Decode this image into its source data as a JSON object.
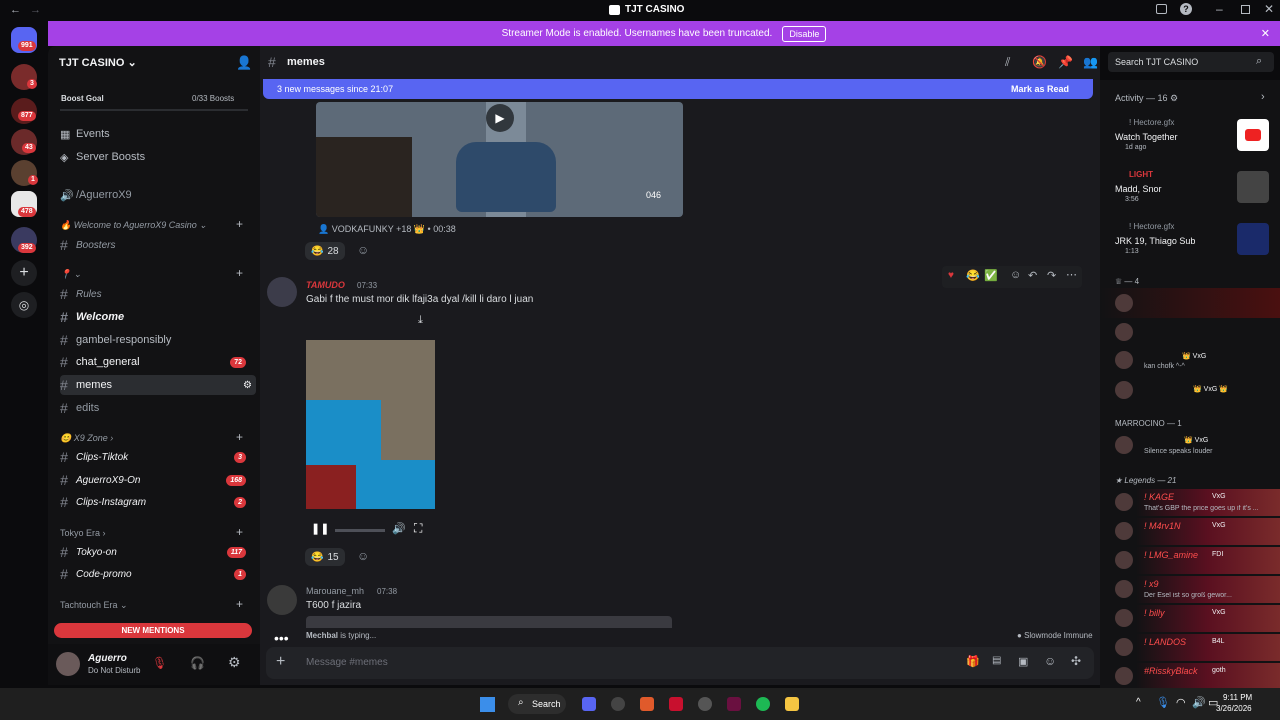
{
  "window": {
    "title": "TJT CASINO"
  },
  "banner": {
    "text": "Streamer Mode is enabled. Usernames have been truncated.",
    "button": "Disable"
  },
  "guilds": {
    "badges": [
      "991",
      "3",
      "877",
      "43",
      "1",
      "478",
      "392"
    ]
  },
  "server": {
    "name": "TJT CASINO",
    "boost_goal": "Boost Goal",
    "boost_count": "0/33 Boosts"
  },
  "sidebar": {
    "events": "Events",
    "server_boosts": "Server Boosts",
    "link_channel": "/AguerroX9",
    "cat1": "Welcome to AguerroX9 Casino",
    "boosters": "Boosters",
    "rules": "Rules",
    "welcome": "Welcome",
    "gamble": "gambel-responsibly",
    "chat_general": "chat_general",
    "chat_general_count": "72",
    "memes": "memes",
    "edits": "edits",
    "cat2": "X9 Zone",
    "clips_tiktok": "Clips-Tiktok",
    "clips_tiktok_count": "3",
    "aguerro_on": "AguerroX9-On",
    "aguerro_on_count": "168",
    "clips_insta": "Clips-Instagram",
    "clips_insta_count": "2",
    "cat3": "Tokyo Era",
    "tokyo_on": "Tokyo-on",
    "tokyo_on_count": "117",
    "code_promo": "Code-promo",
    "code_promo_count": "1",
    "cat4": "Tachtouch Era",
    "new_mentions": "NEW MENTIONS"
  },
  "user": {
    "name": "Aguerro",
    "status": "Do Not Disturb"
  },
  "channel": {
    "name": "memes",
    "search_placeholder": "Search TJT CASINO"
  },
  "new_messages": {
    "text": "3 new messages since 21:07",
    "mark": "Mark as Read"
  },
  "video1": {
    "meta_user": "VODKAFUNKY +18",
    "meta_time": "00:38",
    "overlay": "046"
  },
  "msg1": {
    "reaction_count": "28"
  },
  "msg2": {
    "author": "TAMUDO",
    "time": "07:33",
    "text": "Gabi f the must mor dik lfaji3a dyal /kill li daro l juan",
    "reaction_count": "15"
  },
  "msg3": {
    "author": "Marouane_mh",
    "time": "07:38",
    "text": "T600 f jazira"
  },
  "typing": {
    "user": "Mechbal",
    "text": " is typing...",
    "slowmode": "Slowmode Immune"
  },
  "composer": {
    "placeholder": "Message #memes"
  },
  "activity": {
    "header": "Activity — 16",
    "items": [
      {
        "user": "! Hectore.gfx",
        "title": "Watch Together",
        "sub": "1d ago"
      },
      {
        "user": "LIGHT",
        "title": "Madd, Snor",
        "sub": "3:56"
      },
      {
        "user": "! Hectore.gfx",
        "title": "JRK 19, Thiago Sub",
        "sub": "1:13"
      }
    ]
  },
  "members": {
    "group1": "— 4",
    "g1_tags": [
      "VxG",
      "VxG"
    ],
    "g1_status": "kan chofk ^-^",
    "group2": "MARROCINO — 1",
    "g2_tag": "VxG",
    "g2_status": "Silence speaks louder",
    "group3": "Legends — 21",
    "legends": [
      {
        "name": "! KAGE",
        "tag": "VxG",
        "status": "That's GBP the price goes up if it's ..."
      },
      {
        "name": "! M4rv1N",
        "tag": "VxG",
        "status": ""
      },
      {
        "name": "! LMG_amine",
        "tag": "FDI",
        "status": ""
      },
      {
        "name": "! x9",
        "tag": "",
        "status": "Der Esel ist so groß gewor..."
      },
      {
        "name": "! billy",
        "tag": "VxG",
        "status": ""
      },
      {
        "name": "! LANDOS",
        "tag": "B4L",
        "status": ""
      },
      {
        "name": "#RisskyBlack",
        "tag": "goth",
        "status": ""
      }
    ]
  },
  "taskbar": {
    "search": "Search",
    "time": "9:11 PM",
    "date": "3/26/2026"
  }
}
